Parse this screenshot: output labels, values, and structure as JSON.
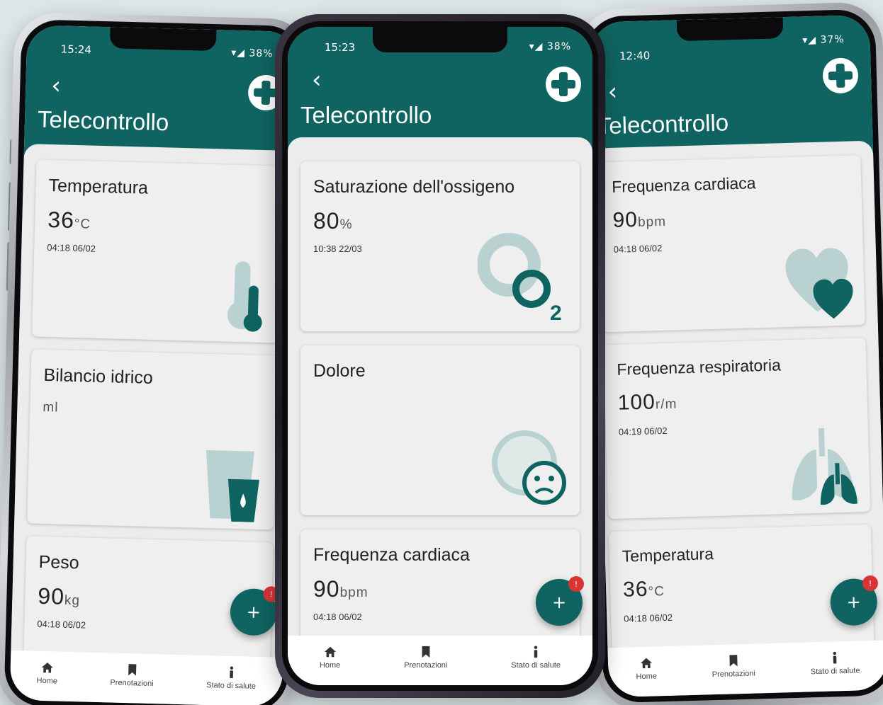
{
  "colors": {
    "brand": "#0f6461",
    "icon_light": "#b9d2d1",
    "icon_dark": "#0f6461",
    "badge": "#d93434",
    "background": "#dde7e7"
  },
  "phones": {
    "left": {
      "status": {
        "time": "15:24",
        "battery": "38%"
      },
      "header": {
        "back": "‹",
        "title": "Telecontrollo"
      },
      "cards": [
        {
          "title": "Temperatura",
          "value": "36",
          "unit": "°C",
          "time": "04:18 06/02",
          "icon": "thermometer-icon"
        },
        {
          "title": "Bilancio idrico",
          "value": "",
          "unit": "ml",
          "time": "",
          "icon": "water-glass-icon"
        },
        {
          "title": "Peso",
          "value": "90",
          "unit": "kg",
          "time": "04:18 06/02",
          "icon": "scale-icon"
        }
      ],
      "fab": {
        "label": "+",
        "badge": "!"
      },
      "nav": [
        {
          "label": "Home",
          "icon": "home-icon"
        },
        {
          "label": "Prenotazioni",
          "icon": "bookmark-icon"
        },
        {
          "label": "Stato di salute",
          "icon": "person-info-icon"
        }
      ]
    },
    "center": {
      "status": {
        "time": "15:23",
        "battery": "38%"
      },
      "header": {
        "back": "‹",
        "title": "Telecontrollo"
      },
      "cards": [
        {
          "title": "Saturazione dell'ossigeno",
          "value": "80",
          "unit": "%",
          "time": "10:38 22/03",
          "icon": "oxygen-icon"
        },
        {
          "title": "Dolore",
          "value": "",
          "unit": "",
          "time": "",
          "icon": "sad-face-icon"
        },
        {
          "title": "Frequenza cardiaca",
          "value": "90",
          "unit": "bpm",
          "time": "04:18 06/02",
          "icon": "heart-icon"
        }
      ],
      "fab": {
        "label": "+",
        "badge": "!"
      },
      "nav": [
        {
          "label": "Home",
          "icon": "home-icon"
        },
        {
          "label": "Prenotazioni",
          "icon": "bookmark-icon"
        },
        {
          "label": "Stato di salute",
          "icon": "person-info-icon"
        }
      ]
    },
    "right": {
      "status": {
        "time": "12:40",
        "battery": "37%"
      },
      "header": {
        "back": "‹",
        "title": "Telecontrollo"
      },
      "cards": [
        {
          "title": "Frequenza cardiaca",
          "value": "90",
          "unit": "bpm",
          "time": "04:18 06/02",
          "icon": "heart-icon"
        },
        {
          "title": "Frequenza respiratoria",
          "value": "100",
          "unit": "r/m",
          "time": "04:19 06/02",
          "icon": "lungs-icon"
        },
        {
          "title": "Temperatura",
          "value": "36",
          "unit": "°C",
          "time": "04:18 06/02",
          "icon": "thermometer-icon"
        }
      ],
      "fab": {
        "label": "+",
        "badge": "!"
      },
      "nav": [
        {
          "label": "Home",
          "icon": "home-icon"
        },
        {
          "label": "Prenotazioni",
          "icon": "bookmark-icon"
        },
        {
          "label": "Stato di salute",
          "icon": "person-info-icon"
        }
      ]
    }
  }
}
